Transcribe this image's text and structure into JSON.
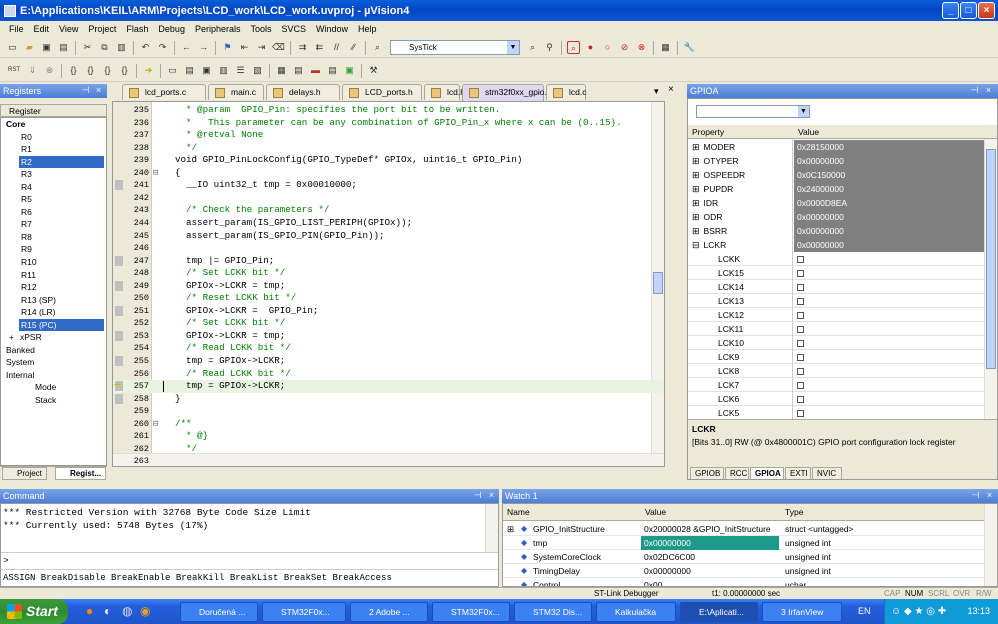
{
  "window": {
    "title": "E:\\Applications\\KEIL\\ARM\\Projects\\LCD_work\\LCD_work.uvproj - µVision4"
  },
  "menu": [
    "File",
    "Edit",
    "View",
    "Project",
    "Flash",
    "Debug",
    "Peripherals",
    "Tools",
    "SVCS",
    "Window",
    "Help"
  ],
  "toolbar": {
    "target_combo": "SysTick"
  },
  "registers": {
    "panel_title": "Registers",
    "column": "Register",
    "rows": [
      {
        "label": "Core",
        "indent": 1,
        "bold": true,
        "expander": "−"
      },
      {
        "label": "R0",
        "indent": 2
      },
      {
        "label": "R1",
        "indent": 2
      },
      {
        "label": "R2",
        "indent": 2,
        "selected": true
      },
      {
        "label": "R3",
        "indent": 2
      },
      {
        "label": "R4",
        "indent": 2
      },
      {
        "label": "R5",
        "indent": 2
      },
      {
        "label": "R6",
        "indent": 2
      },
      {
        "label": "R7",
        "indent": 2
      },
      {
        "label": "R8",
        "indent": 2
      },
      {
        "label": "R9",
        "indent": 2
      },
      {
        "label": "R10",
        "indent": 2
      },
      {
        "label": "R11",
        "indent": 2
      },
      {
        "label": "R12",
        "indent": 2
      },
      {
        "label": "R13 (SP)",
        "indent": 2
      },
      {
        "label": "R14 (LR)",
        "indent": 2
      },
      {
        "label": "R15 (PC)",
        "indent": 2,
        "selected": true
      },
      {
        "label": "xPSR",
        "indent": 2,
        "expander": "+"
      },
      {
        "label": "Banked",
        "indent": 1,
        "expander": "+"
      },
      {
        "label": "System",
        "indent": 1,
        "expander": "+"
      },
      {
        "label": "Internal",
        "indent": 1,
        "expander": "−"
      },
      {
        "label": "Mode",
        "indent": 3
      },
      {
        "label": "Stack",
        "indent": 3
      }
    ],
    "tabs": [
      "Project",
      "Regist..."
    ]
  },
  "tabs": [
    {
      "label": "lcd_ports.c"
    },
    {
      "label": "main.c"
    },
    {
      "label": "delays.h"
    },
    {
      "label": "LCD_ports.h"
    },
    {
      "label": "lcd.h"
    },
    {
      "label": "stm32f0xx_gpio.c",
      "active": true
    },
    {
      "label": "lcd.c"
    }
  ],
  "code": [
    {
      "n": "235",
      "t": "  * @param  GPIO_Pin: specifies the port bit to be written.",
      "c": "cm"
    },
    {
      "n": "236",
      "t": "  *   This parameter can be any combination of GPIO_Pin_x where x can be (0..15).",
      "c": "cm"
    },
    {
      "n": "237",
      "t": "  * @retval None",
      "c": "cm"
    },
    {
      "n": "238",
      "t": "  */",
      "c": "cm"
    },
    {
      "n": "239",
      "t": "void GPIO_PinLockConfig(GPIO_TypeDef* GPIOx, uint16_t GPIO_Pin)"
    },
    {
      "n": "240",
      "t": "{",
      "fold": true
    },
    {
      "n": "241",
      "t": "  __IO uint32_t tmp = 0x00010000;",
      "mark": true
    },
    {
      "n": "242",
      "t": ""
    },
    {
      "n": "243",
      "t": "  /* Check the parameters */",
      "c": "cm"
    },
    {
      "n": "244",
      "t": "  assert_param(IS_GPIO_LIST_PERIPH(GPIOx));"
    },
    {
      "n": "245",
      "t": "  assert_param(IS_GPIO_PIN(GPIO_Pin));"
    },
    {
      "n": "246",
      "t": ""
    },
    {
      "n": "247",
      "t": "  tmp |= GPIO_Pin;",
      "mark": true
    },
    {
      "n": "248",
      "t": "  /* Set LCKK bit */",
      "c": "cm"
    },
    {
      "n": "249",
      "t": "  GPIOx->LCKR = tmp;",
      "mark": true
    },
    {
      "n": "250",
      "t": "  /* Reset LCKK bit */",
      "c": "cm"
    },
    {
      "n": "251",
      "t": "  GPIOx->LCKR =  GPIO_Pin;",
      "mark": true
    },
    {
      "n": "252",
      "t": "  /* Set LCKK bit */",
      "c": "cm"
    },
    {
      "n": "253",
      "t": "  GPIOx->LCKR = tmp;",
      "mark": true
    },
    {
      "n": "254",
      "t": "  /* Read LCKK bit */",
      "c": "cm"
    },
    {
      "n": "255",
      "t": "  tmp = GPIOx->LCKR;",
      "mark": true
    },
    {
      "n": "256",
      "t": "  /* Read LCKK bit */",
      "c": "cm"
    },
    {
      "n": "257",
      "t": "  tmp = GPIOx->LCKR;",
      "mark": true,
      "current": true
    },
    {
      "n": "258",
      "t": "}",
      "mark": true
    },
    {
      "n": "259",
      "t": ""
    },
    {
      "n": "260",
      "t": "/**",
      "c": "cm",
      "fold": true
    },
    {
      "n": "261",
      "t": "  * @}",
      "c": "cm"
    },
    {
      "n": "262",
      "t": "  */",
      "c": "cm"
    },
    {
      "n": "263",
      "t": ""
    }
  ],
  "gpio": {
    "panel_title": "GPIOA",
    "col_property": "Property",
    "col_value": "Value",
    "rows": [
      {
        "name": "MODER",
        "value": "0x28150000",
        "exp": "+",
        "gray": true
      },
      {
        "name": "OTYPER",
        "value": "0x00000000",
        "exp": "+",
        "gray": true
      },
      {
        "name": "OSPEEDR",
        "value": "0x0C150000",
        "exp": "+",
        "gray": true
      },
      {
        "name": "PUPDR",
        "value": "0x24000000",
        "exp": "+",
        "gray": true
      },
      {
        "name": "IDR",
        "value": "0x0000D8EA",
        "exp": "+",
        "gray": true
      },
      {
        "name": "ODR",
        "value": "0x00000000",
        "exp": "+",
        "gray": true
      },
      {
        "name": "BSRR",
        "value": "0x00000000",
        "exp": "+",
        "gray": true
      },
      {
        "name": "LCKR",
        "value": "0x00000000",
        "exp": "−",
        "gray": true
      },
      {
        "name": "LCKK",
        "check": true
      },
      {
        "name": "LCK15",
        "check": true
      },
      {
        "name": "LCK14",
        "check": true
      },
      {
        "name": "LCK13",
        "check": true
      },
      {
        "name": "LCK12",
        "check": true
      },
      {
        "name": "LCK11",
        "check": true
      },
      {
        "name": "LCK10",
        "check": true
      },
      {
        "name": "LCK9",
        "check": true
      },
      {
        "name": "LCK8",
        "check": true
      },
      {
        "name": "LCK7",
        "check": true
      },
      {
        "name": "LCK6",
        "check": true
      },
      {
        "name": "LCK5",
        "check": true
      }
    ],
    "desc_title": "LCKR",
    "desc_text": "[Bits 31..0] RW (@ 0x4800001C) GPIO port configuration lock register",
    "tabs": [
      {
        "label": "GPIOB"
      },
      {
        "label": "RCC"
      },
      {
        "label": "GPIOA",
        "active": true
      },
      {
        "label": "EXTI"
      },
      {
        "label": "NVIC"
      }
    ]
  },
  "command": {
    "panel_title": "Command",
    "lines": [
      "*** Restricted Version with 32768 Byte Code Size Limit",
      "*** Currently used: 5748 Bytes (17%)"
    ],
    "prompt": ">",
    "help": "ASSIGN BreakDisable BreakEnable BreakKill BreakList BreakSet BreakAccess"
  },
  "watch": {
    "panel_title": "Watch 1",
    "cols": [
      "Name",
      "Value",
      "Type"
    ],
    "rows": [
      {
        "name": "GPIO_InitStructure",
        "value": "0x20000028 &GPIO_InitStructure",
        "type": "struct <untagged>",
        "exp": "+"
      },
      {
        "name": "tmp",
        "value": "0x00000000",
        "type": "unsigned int",
        "hl": true
      },
      {
        "name": "SystemCoreClock",
        "value": "0x02DC6C00",
        "type": "unsigned int"
      },
      {
        "name": "TimingDelay",
        "value": "0x00000000",
        "type": "unsigned int"
      },
      {
        "name": "Control",
        "value": "0x00",
        "type": "uchar"
      }
    ]
  },
  "status": {
    "debugger": "ST-Link Debugger",
    "time": "t1: 0.00000000 sec",
    "cap": "CAP",
    "num": "NUM",
    "scrl": "SCRL",
    "ovr": "OVR",
    "rw": "R/W"
  },
  "taskbar": {
    "start": "Start",
    "tasks": [
      "Doručená ...",
      "STM32F0x...",
      "2 Adobe ...",
      "STM32F0x...",
      "STM32 Dis...",
      "Kalkulačka",
      "E:\\Aplicati...",
      "3 IrfanView"
    ],
    "lang": "EN",
    "clock": "13:13"
  },
  "colors": {
    "title": "#0a55d0",
    "selection": "#316ac5",
    "comment": "#008000",
    "watch_hl": "#1e9a8a"
  }
}
